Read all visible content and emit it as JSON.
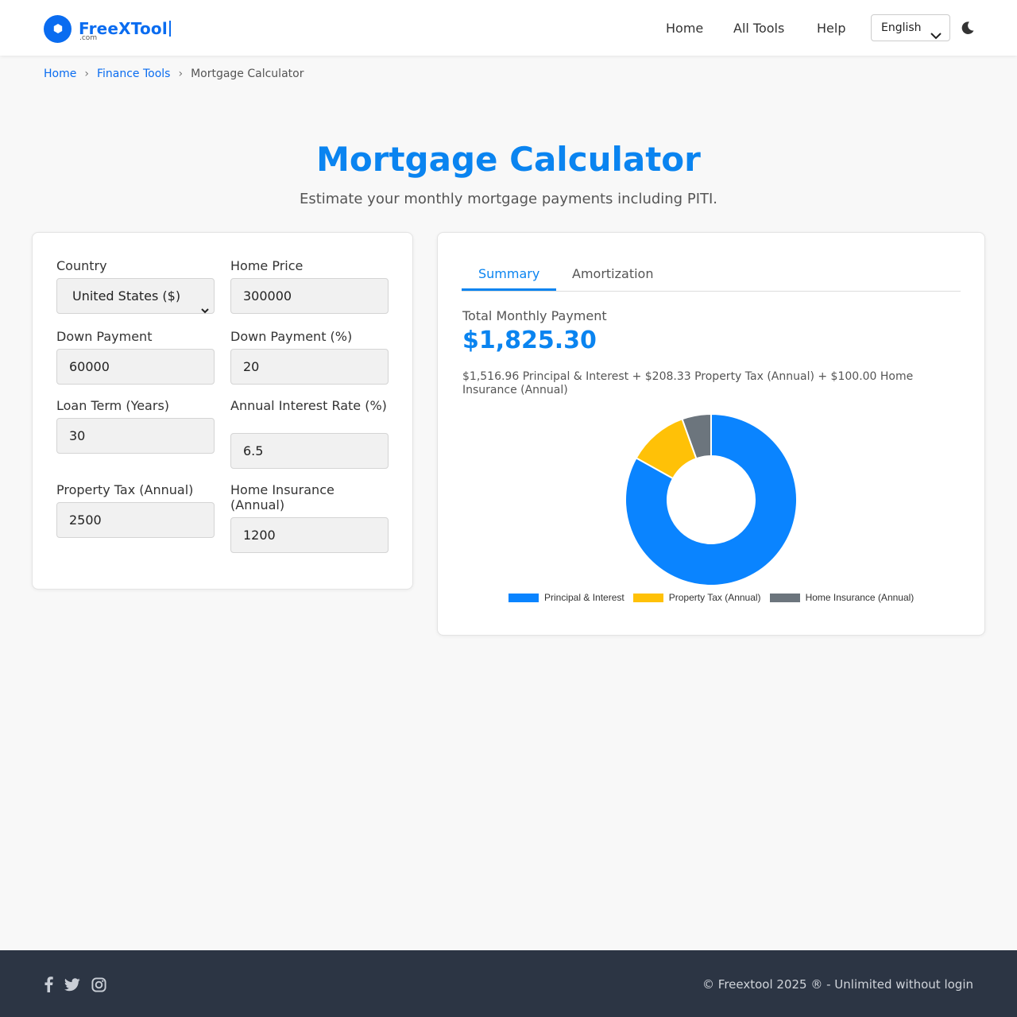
{
  "header": {
    "logo_name": "FreeXTool",
    "logo_suffix": ".com",
    "nav": [
      "Home",
      "All Tools",
      "Help"
    ],
    "language": "English"
  },
  "breadcrumb": {
    "items": [
      "Home",
      "Finance Tools"
    ],
    "current": "Mortgage Calculator"
  },
  "page": {
    "title": "Mortgage Calculator",
    "subtitle": "Estimate your monthly mortgage payments including PITI."
  },
  "form": {
    "country_label": "Country",
    "country_value": "United States ($)",
    "home_price_label": "Home Price",
    "home_price_value": "300000",
    "down_payment_label": "Down Payment",
    "down_payment_value": "60000",
    "down_payment_pct_label": "Down Payment (%)",
    "down_payment_pct_value": "20",
    "loan_term_label": "Loan Term (Years)",
    "loan_term_value": "30",
    "interest_rate_label": "Annual Interest Rate (%)",
    "interest_rate_value": "6.5",
    "property_tax_label": "Property Tax (Annual)",
    "property_tax_value": "2500",
    "home_insurance_label": "Home Insurance (Annual)",
    "home_insurance_value": "1200"
  },
  "result": {
    "tabs": [
      "Summary",
      "Amortization"
    ],
    "active_tab": "Summary",
    "total_label": "Total Monthly Payment",
    "total_value": "$1,825.30",
    "breakdown": "$1,516.96 Principal & Interest + $208.33 Property Tax (Annual) + $100.00 Home Insurance (Annual)"
  },
  "chart_data": {
    "type": "pie",
    "categories": [
      "Principal & Interest",
      "Property Tax (Annual)",
      "Home Insurance (Annual)"
    ],
    "values": [
      1516.96,
      208.33,
      100.0
    ],
    "colors": [
      "#0a84ff",
      "#ffc107",
      "#6c757d"
    ],
    "legend_position": "bottom"
  },
  "footer": {
    "social_icons": [
      "facebook-icon",
      "twitter-icon",
      "instagram-icon"
    ],
    "copyright": "© Freextool 2025 ® - Unlimited without login"
  }
}
